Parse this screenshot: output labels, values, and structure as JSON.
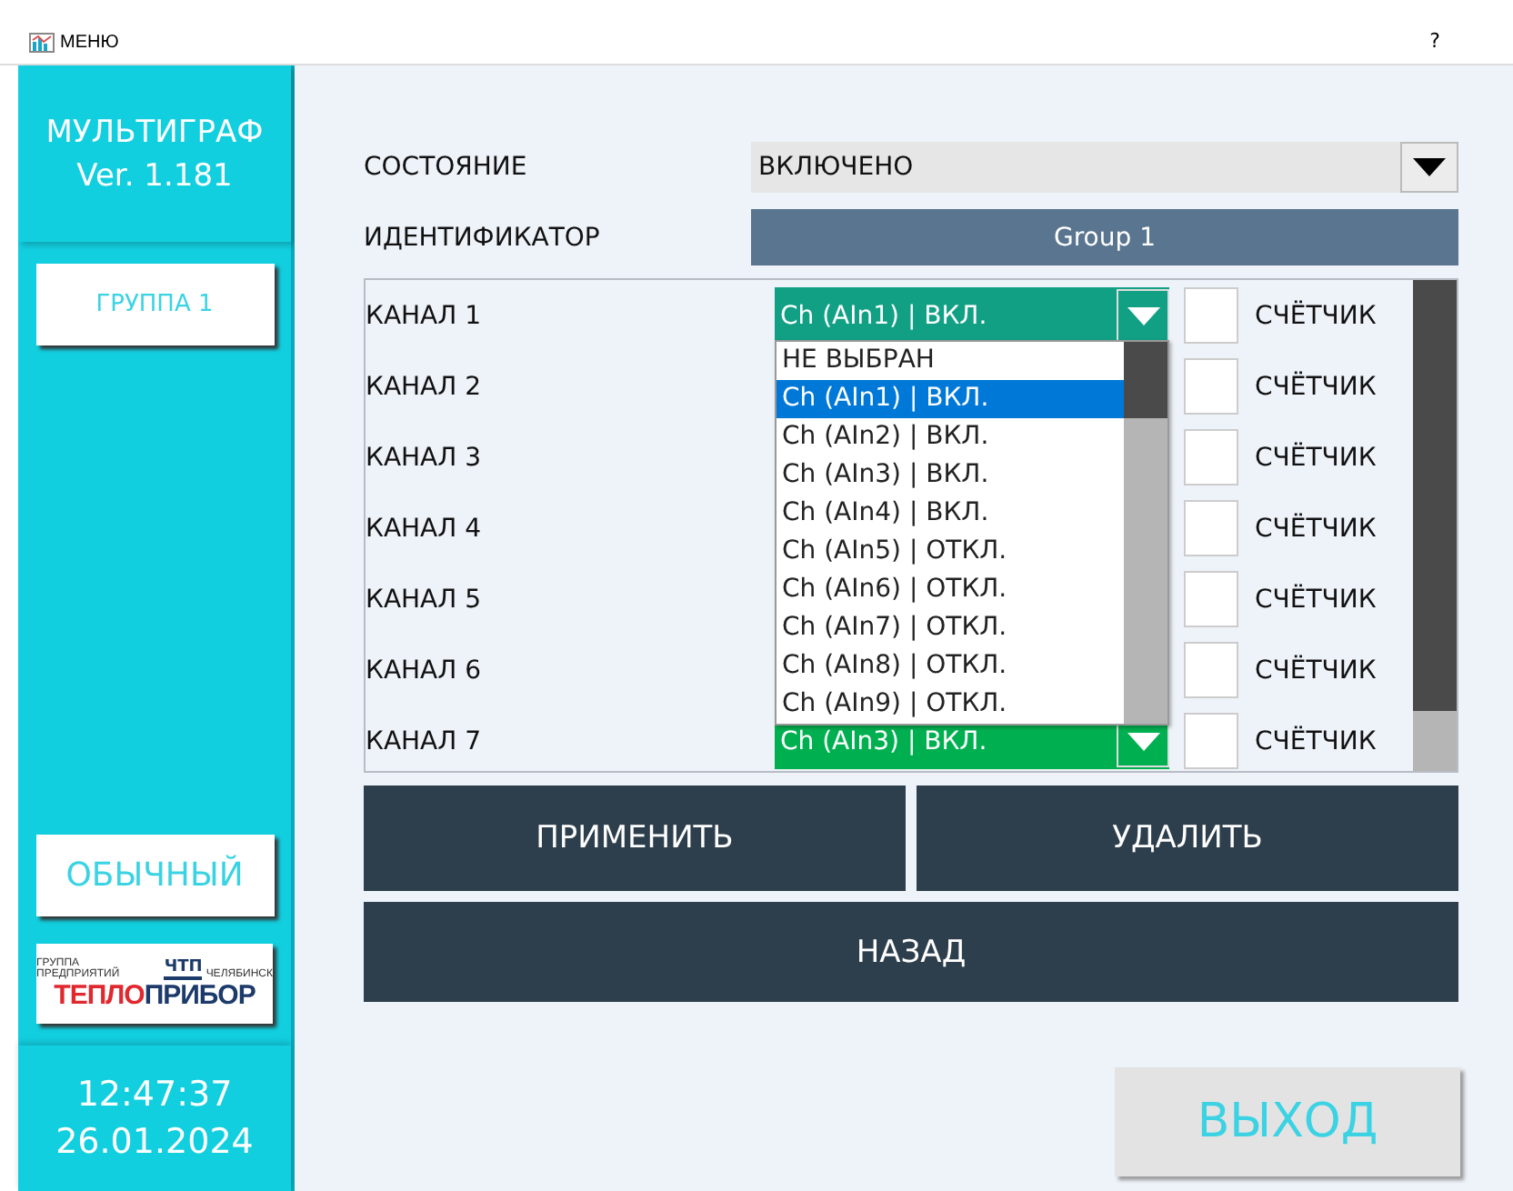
{
  "window": {
    "title": "МЕНЮ",
    "help": "?"
  },
  "sidebar": {
    "app_name": "МУЛЬТИГРАФ",
    "version": "Ver. 1.181",
    "group_button": "ГРУППА 1",
    "mode_button": "ОБЫЧНЫЙ",
    "logo": {
      "top_left": "ГРУППА ПРЕДПРИЯТИЙ",
      "emblem": "ЧТП",
      "top_right": "ЧЕЛЯБИНСК",
      "name_red": "ТЕПЛО",
      "name_blue": "ПРИБОР"
    },
    "time": "12:47:37",
    "date": "26.01.2024"
  },
  "form": {
    "state_label": "СОСТОЯНИЕ",
    "state_value": "ВКЛЮЧЕНО",
    "id_label": "ИДЕНТИФИКАТОР",
    "id_value": "Group 1"
  },
  "channels": [
    {
      "name": "КАНАЛ 1",
      "value": "Ch (AIn1) | ВКЛ.",
      "open": true,
      "counter_label": "СЧЁТЧИК",
      "counter_checked": false
    },
    {
      "name": "КАНАЛ 2",
      "counter_label": "СЧЁТЧИК",
      "counter_checked": false
    },
    {
      "name": "КАНАЛ 3",
      "counter_label": "СЧЁТЧИК",
      "counter_checked": false
    },
    {
      "name": "КАНАЛ 4",
      "counter_label": "СЧЁТЧИК",
      "counter_checked": false
    },
    {
      "name": "КАНАЛ 5",
      "counter_label": "СЧЁТЧИК",
      "counter_checked": false
    },
    {
      "name": "КАНАЛ 6",
      "counter_label": "СЧЁТЧИК",
      "counter_checked": false
    },
    {
      "name": "КАНАЛ 7",
      "value": "Ch (AIn3) | ВКЛ.",
      "open": false,
      "counter_label": "СЧЁТЧИК",
      "counter_checked": false
    }
  ],
  "dropdown_options": [
    {
      "label": "НЕ ВЫБРАН",
      "selected": false
    },
    {
      "label": "Ch (AIn1) | ВКЛ.",
      "selected": true
    },
    {
      "label": "Ch (AIn2) | ВКЛ.",
      "selected": false
    },
    {
      "label": "Ch (AIn3) | ВКЛ.",
      "selected": false
    },
    {
      "label": "Ch (AIn4) | ВКЛ.",
      "selected": false
    },
    {
      "label": "Ch (AIn5) | ОТКЛ.",
      "selected": false
    },
    {
      "label": "Ch (AIn6) | ОТКЛ.",
      "selected": false
    },
    {
      "label": "Ch (AIn7) | ОТКЛ.",
      "selected": false
    },
    {
      "label": "Ch (AIn8) | ОТКЛ.",
      "selected": false
    },
    {
      "label": "Ch (AIn9) | ОТКЛ.",
      "selected": false
    }
  ],
  "buttons": {
    "apply": "ПРИМЕНИТЬ",
    "delete": "УДАЛИТЬ",
    "back": "НАЗАД",
    "exit": "ВЫХОД"
  }
}
